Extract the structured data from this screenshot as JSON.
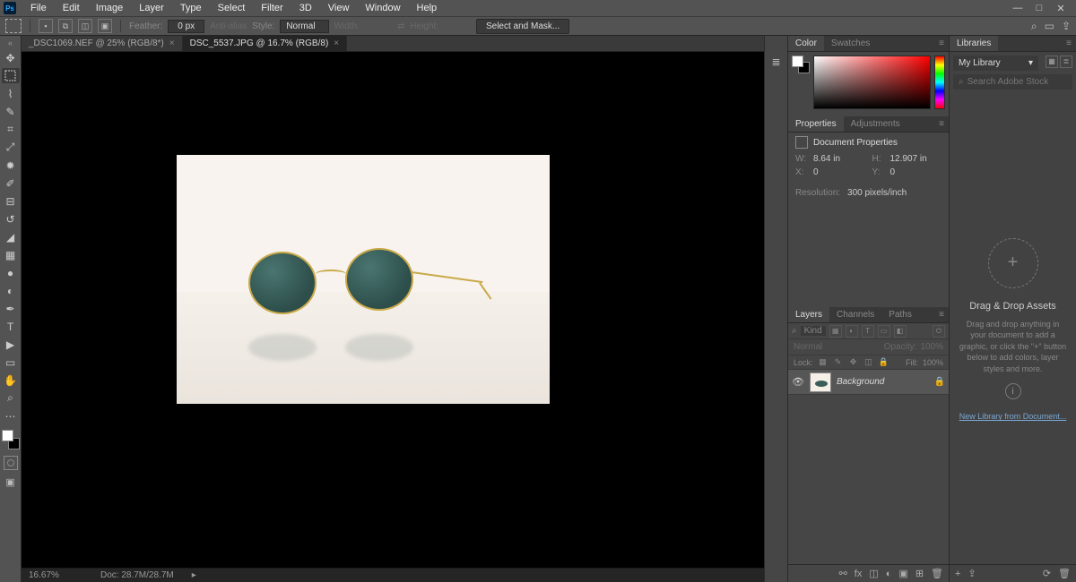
{
  "menubar": [
    "File",
    "Edit",
    "Image",
    "Layer",
    "Type",
    "Select",
    "Filter",
    "3D",
    "View",
    "Window",
    "Help"
  ],
  "options": {
    "feather_label": "Feather:",
    "feather_value": "0 px",
    "antialias": "Anti-alias",
    "style_label": "Style:",
    "style_value": "Normal",
    "width_label": "Width:",
    "height_label": "Height:",
    "select_mask": "Select and Mask..."
  },
  "tabs": [
    {
      "label": "_DSC1069.NEF @ 25% (RGB/8*)",
      "active": false
    },
    {
      "label": "DSC_5537.JPG @ 16.7% (RGB/8)",
      "active": true
    }
  ],
  "status": {
    "zoom": "16.67%",
    "doc": "Doc: 28.7M/28.7M"
  },
  "color_panel": {
    "tabs": [
      "Color",
      "Swatches"
    ]
  },
  "properties_panel": {
    "tabs": [
      "Properties",
      "Adjustments"
    ],
    "title": "Document Properties",
    "w_label": "W:",
    "w_value": "8.64 in",
    "h_label": "H:",
    "h_value": "12.907 in",
    "x_label": "X:",
    "x_value": "0",
    "y_label": "Y:",
    "y_value": "0",
    "res_label": "Resolution:",
    "res_value": "300 pixels/inch"
  },
  "layers_panel": {
    "tabs": [
      "Layers",
      "Channels",
      "Paths"
    ],
    "kind": "Kind",
    "blend": "Normal",
    "opacity_label": "Opacity:",
    "opacity_value": "100%",
    "lock_label": "Lock:",
    "fill_label": "Fill:",
    "fill_value": "100%",
    "layer_name": "Background"
  },
  "libraries": {
    "tab": "Libraries",
    "dropdown": "My Library",
    "search_placeholder": "Search Adobe Stock",
    "title": "Drag & Drop Assets",
    "desc": "Drag and drop anything in your document to add a graphic, or click the \"+\" button below to add colors, layer styles and more.",
    "link": "New Library from Document..."
  }
}
